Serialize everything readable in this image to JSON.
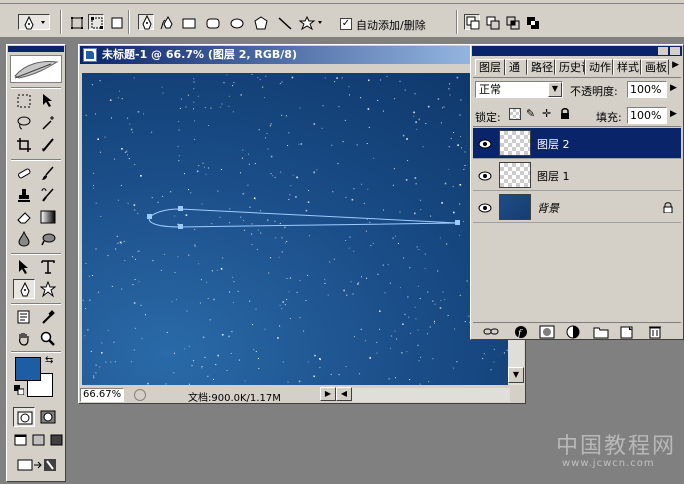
{
  "options_bar": {
    "auto_add_delete_label": "自动添加/删除",
    "auto_add_delete_checked": true
  },
  "document": {
    "title": "未标题-1 @ 66.7% (图层 2, RGB/8)",
    "zoom": "66.67%",
    "doc_info": "文档:900.0K/1.17M"
  },
  "layers_panel": {
    "tabs": [
      "图层",
      "通",
      "路径",
      "历史记录",
      "动作",
      "样式",
      "画板"
    ],
    "active_tab": "图层",
    "blend_mode": "正常",
    "opacity_label": "不透明度:",
    "opacity_value": "100%",
    "lock_label": "锁定:",
    "fill_label": "填充:",
    "fill_value": "100%",
    "layers": [
      {
        "name": "图层 2",
        "selected": true,
        "visible": true,
        "thumb": "transparent"
      },
      {
        "name": "图层 1",
        "selected": false,
        "visible": true,
        "thumb": "transparent"
      },
      {
        "name": "背景",
        "selected": false,
        "visible": true,
        "thumb": "background",
        "locked": true
      }
    ]
  },
  "colors": {
    "foreground": "#1d5da4",
    "background": "#ffffff",
    "canvas_dark": "#0f3a6e",
    "canvas_light": "#2a6aa8",
    "path": "#9ecbff",
    "selection": "#0a246a"
  },
  "watermark": {
    "cn": "中国教程网",
    "url": "www.jcwcn.com"
  }
}
